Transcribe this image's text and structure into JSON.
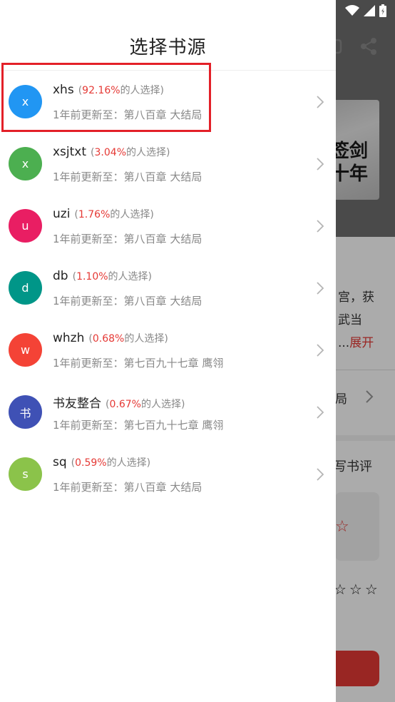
{
  "drawer": {
    "title": "选择书源",
    "sources": [
      {
        "avatar": "x",
        "color": "#2196f3",
        "name": "xhs",
        "pct_open": "(",
        "pct": "92.16%",
        "pct_suffix": "的人选择)",
        "update": "1年前更新至：第八百章 大结局"
      },
      {
        "avatar": "x",
        "color": "#4caf50",
        "name": "xsjtxt",
        "pct_open": "(",
        "pct": "3.04%",
        "pct_suffix": "的人选择)",
        "update": "1年前更新至：第八百章 大结局"
      },
      {
        "avatar": "u",
        "color": "#e91e63",
        "name": "uzi",
        "pct_open": "(",
        "pct": "1.76%",
        "pct_suffix": "的人选择)",
        "update": "1年前更新至：第八百章 大结局"
      },
      {
        "avatar": "d",
        "color": "#009688",
        "name": "db",
        "pct_open": "(",
        "pct": "1.10%",
        "pct_suffix": "的人选择)",
        "update": "1年前更新至：第八百章 大结局"
      },
      {
        "avatar": "w",
        "color": "#f44336",
        "name": "whzh",
        "pct_open": "(",
        "pct": "0.68%",
        "pct_suffix": "的人选择)",
        "update": "1年前更新至：第七百九十七章 鹰翎"
      },
      {
        "avatar": "书",
        "color": "#3f51b5",
        "name": "书友整合",
        "pct_open": "(",
        "pct": "0.67%",
        "pct_suffix": "的人选择)",
        "update": "1年前更新至：第七百九十七章 鹰翎"
      },
      {
        "avatar": "s",
        "color": "#8bc34a",
        "name": "sq",
        "pct_open": "(",
        "pct": "0.59%",
        "pct_suffix": "的人选择)",
        "update": "1年前更新至：第八百章 大结局"
      }
    ]
  },
  "background": {
    "cover_text": "签剑\n十年",
    "desc_line1": "宫，获",
    "desc_line2": "武当",
    "desc_ellipsis": "...",
    "expand_label": "展开",
    "chapter_label": "局",
    "review_label": "写书评",
    "stars": "☆☆☆",
    "big_star": "☆"
  },
  "colors": {
    "accent": "#e53935",
    "highlight": "#e32028"
  }
}
